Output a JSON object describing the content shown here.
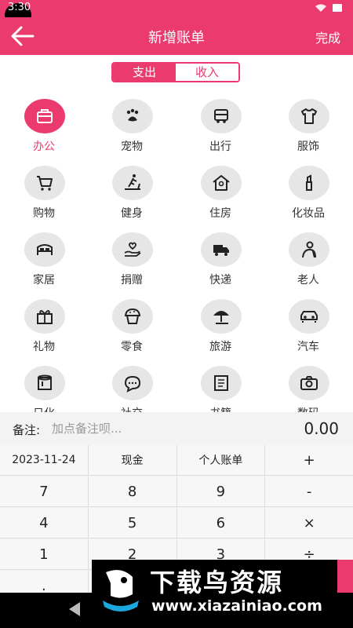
{
  "status": {
    "time": "3:30"
  },
  "header": {
    "title": "新增账单",
    "done_label": "完成"
  },
  "toggle": {
    "expense_label": "支出",
    "income_label": "收入"
  },
  "colors": {
    "accent": "#ea3a6e",
    "icon_bg": "#e6e6e6"
  },
  "categories": [
    {
      "label": "办公",
      "icon": "briefcase-icon",
      "selected": true
    },
    {
      "label": "宠物",
      "icon": "paw-icon"
    },
    {
      "label": "出行",
      "icon": "bus-icon"
    },
    {
      "label": "服饰",
      "icon": "shirt-icon"
    },
    {
      "label": "购物",
      "icon": "cart-icon"
    },
    {
      "label": "健身",
      "icon": "treadmill-icon"
    },
    {
      "label": "住房",
      "icon": "house-icon"
    },
    {
      "label": "化妆品",
      "icon": "lipstick-icon"
    },
    {
      "label": "家居",
      "icon": "bed-icon"
    },
    {
      "label": "捐赠",
      "icon": "heart-hand-icon"
    },
    {
      "label": "快递",
      "icon": "truck-icon"
    },
    {
      "label": "老人",
      "icon": "elder-icon"
    },
    {
      "label": "礼物",
      "icon": "gift-icon"
    },
    {
      "label": "零食",
      "icon": "cupcake-icon"
    },
    {
      "label": "旅游",
      "icon": "umbrella-icon"
    },
    {
      "label": "汽车",
      "icon": "car-icon"
    },
    {
      "label": "日化",
      "icon": "tissue-icon"
    },
    {
      "label": "社交",
      "icon": "chat-icon"
    },
    {
      "label": "书籍",
      "icon": "book-icon"
    },
    {
      "label": "数码",
      "icon": "camera-icon"
    }
  ],
  "note": {
    "label": "备注:",
    "placeholder": "加点备注呗...",
    "amount": "0.00"
  },
  "keypad": {
    "rows": [
      [
        "2023-11-24",
        "现金",
        "个人账单",
        "+"
      ],
      [
        "7",
        "8",
        "9",
        "-"
      ],
      [
        "4",
        "5",
        "6",
        "×"
      ],
      [
        "1",
        "2",
        "3",
        "÷"
      ],
      [
        ".",
        "",
        "",
        ""
      ]
    ]
  },
  "watermark": {
    "text": "下载鸟资源",
    "url": "www.xiazainiao.com"
  }
}
